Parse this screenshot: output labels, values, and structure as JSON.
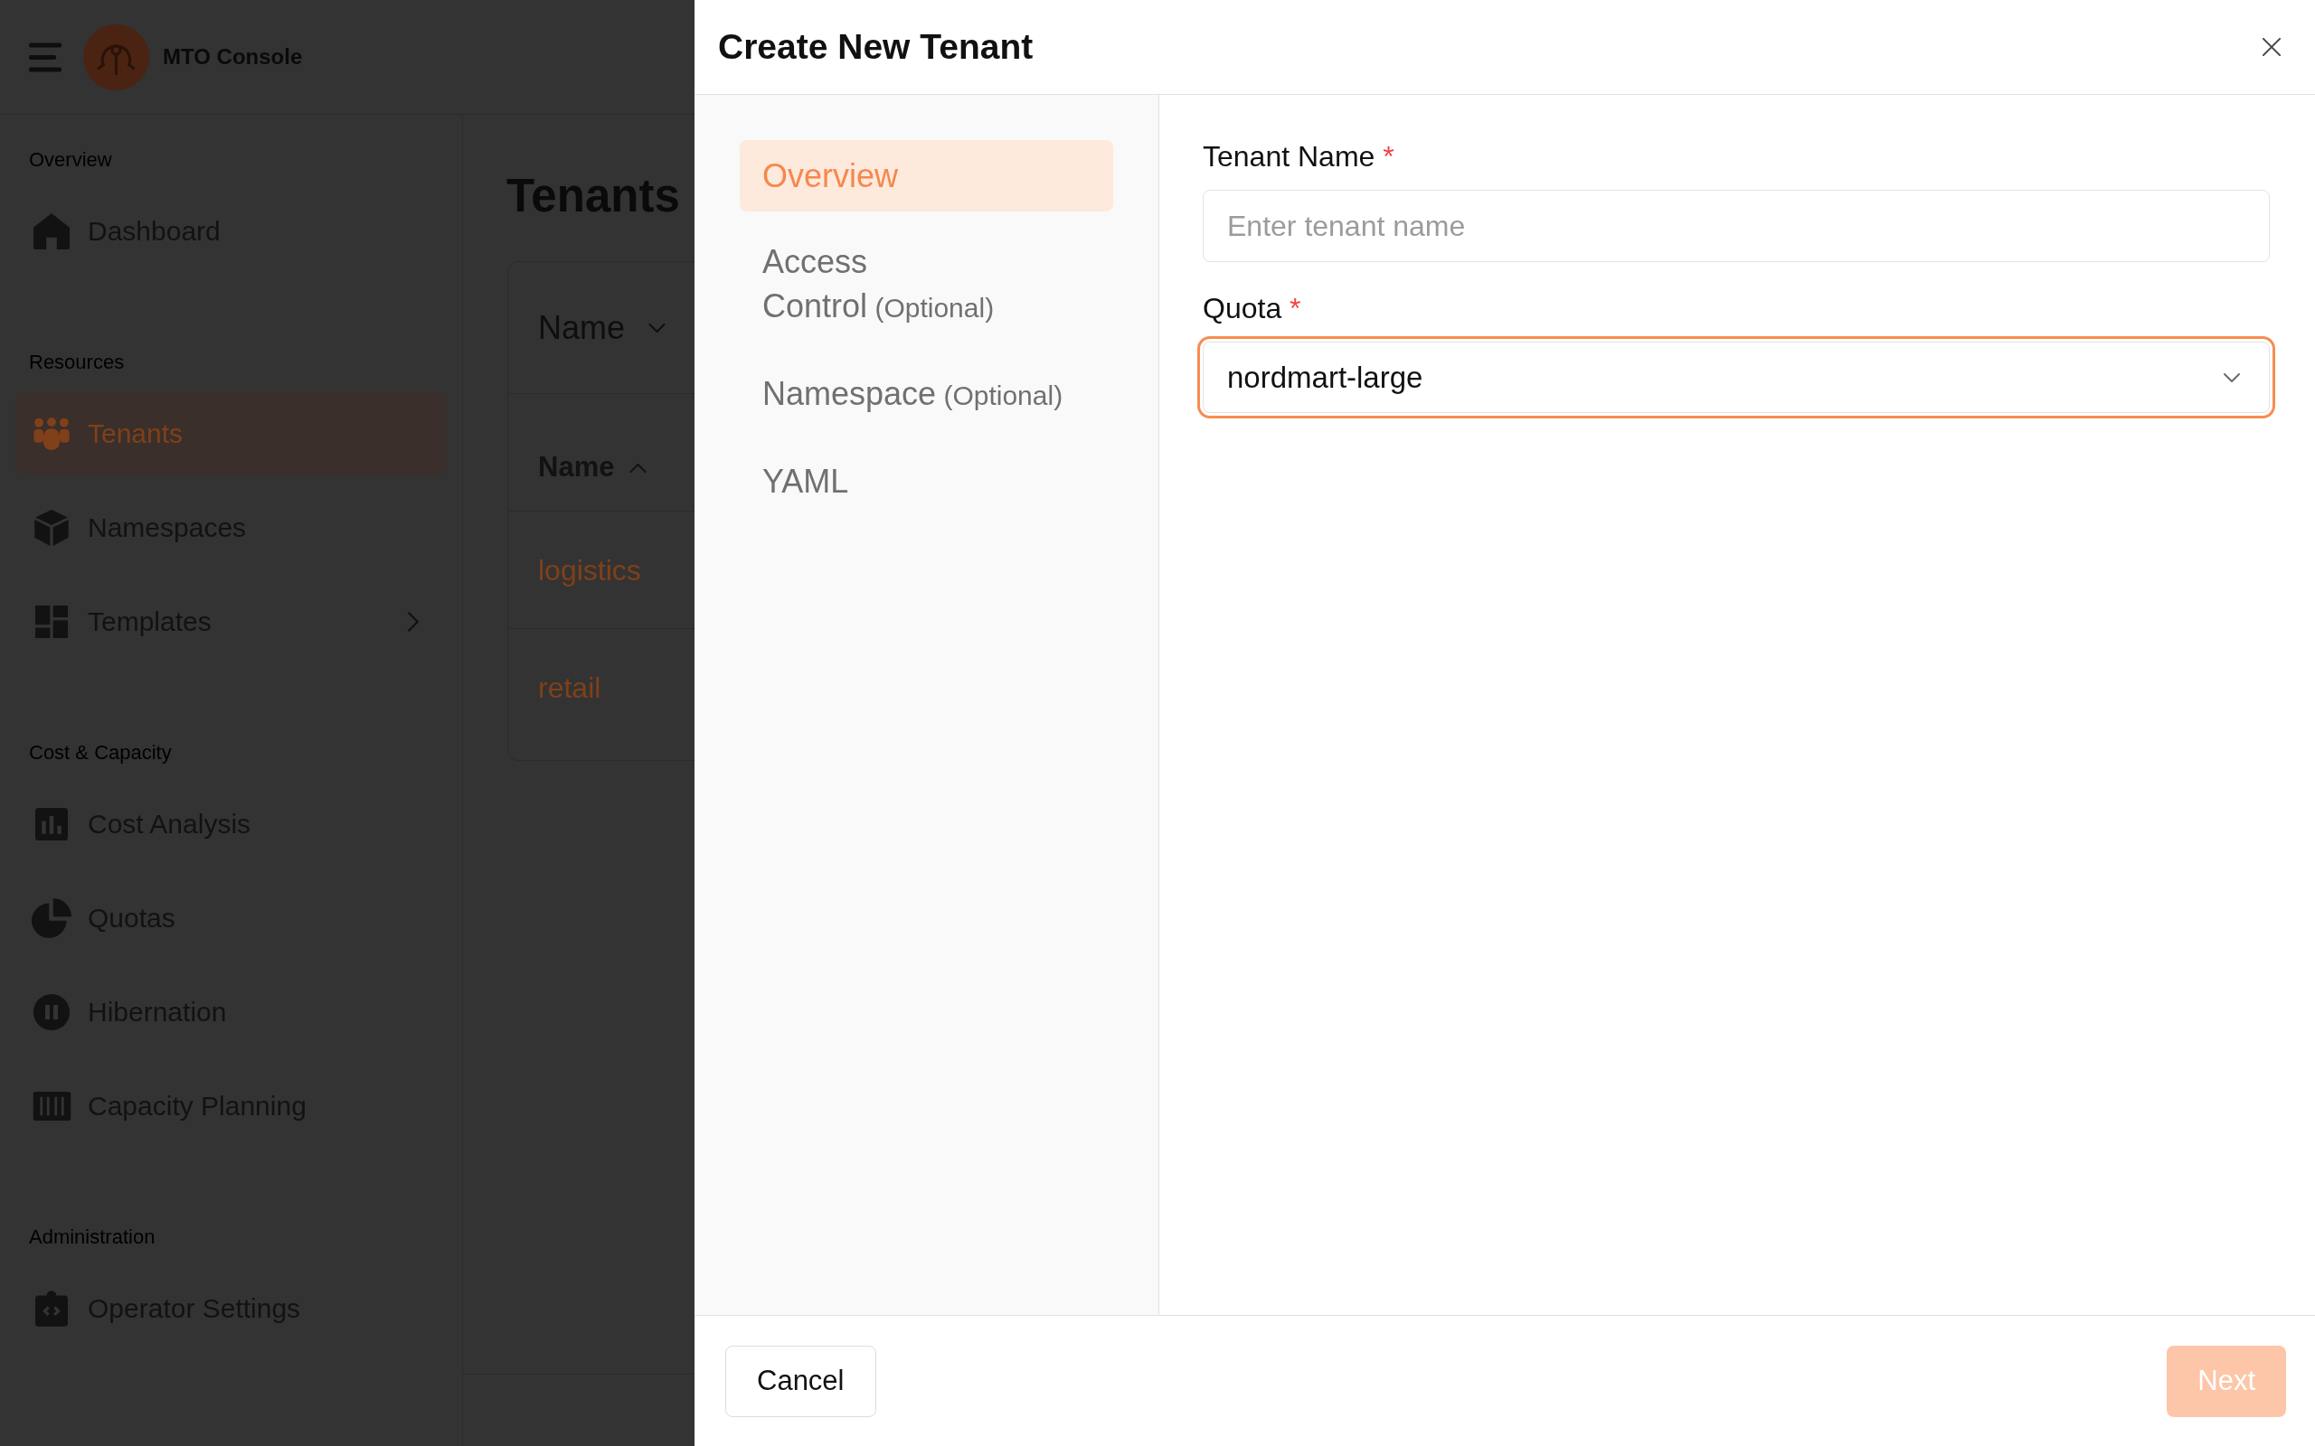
{
  "app_header": {
    "title": "MTO Console"
  },
  "sidebar": {
    "sections": [
      {
        "label": "Overview",
        "items": [
          {
            "label": "Dashboard",
            "selected": false
          }
        ]
      },
      {
        "label": "Resources",
        "items": [
          {
            "label": "Tenants",
            "selected": true
          },
          {
            "label": "Namespaces",
            "selected": false
          },
          {
            "label": "Templates",
            "selected": false,
            "expanded": false
          }
        ]
      },
      {
        "label": "Cost & Capacity",
        "items": [
          {
            "label": "Cost Analysis",
            "selected": false
          },
          {
            "label": "Quotas",
            "selected": false
          },
          {
            "label": "Hibernation",
            "selected": false
          },
          {
            "label": "Capacity Planning",
            "selected": false
          }
        ]
      },
      {
        "label": "Administration",
        "items": [
          {
            "label": "Operator Settings",
            "selected": false
          }
        ]
      }
    ]
  },
  "main": {
    "title": "Tenants",
    "table": {
      "filter": {
        "label": "Name"
      },
      "columns": [
        {
          "label": "Name",
          "sort_ascending": true
        }
      ],
      "rows": [
        {
          "name": "logistics"
        },
        {
          "name": "retail"
        }
      ]
    }
  },
  "dialog": {
    "title": "Create New Tenant",
    "steps": [
      {
        "label": "Overview",
        "selected": true
      },
      {
        "label": "Access Control",
        "suffix": "(Optional)",
        "selected": false
      },
      {
        "label": "Namespace",
        "suffix": "(Optional)",
        "selected": false
      },
      {
        "label": "YAML",
        "selected": false
      }
    ],
    "fields": [
      {
        "kind": "text",
        "label": "Tenant Name",
        "required_mark": "*",
        "placeholder": "Enter tenant name",
        "focused": false
      },
      {
        "kind": "select",
        "label": "Quota",
        "required_mark": "*",
        "value": "nordmart-large",
        "focused": true
      }
    ],
    "buttons": [
      {
        "label": "Cancel",
        "kind": "secondary",
        "disabled": false
      },
      {
        "label": "Next",
        "kind": "primary",
        "disabled": true
      }
    ]
  }
}
